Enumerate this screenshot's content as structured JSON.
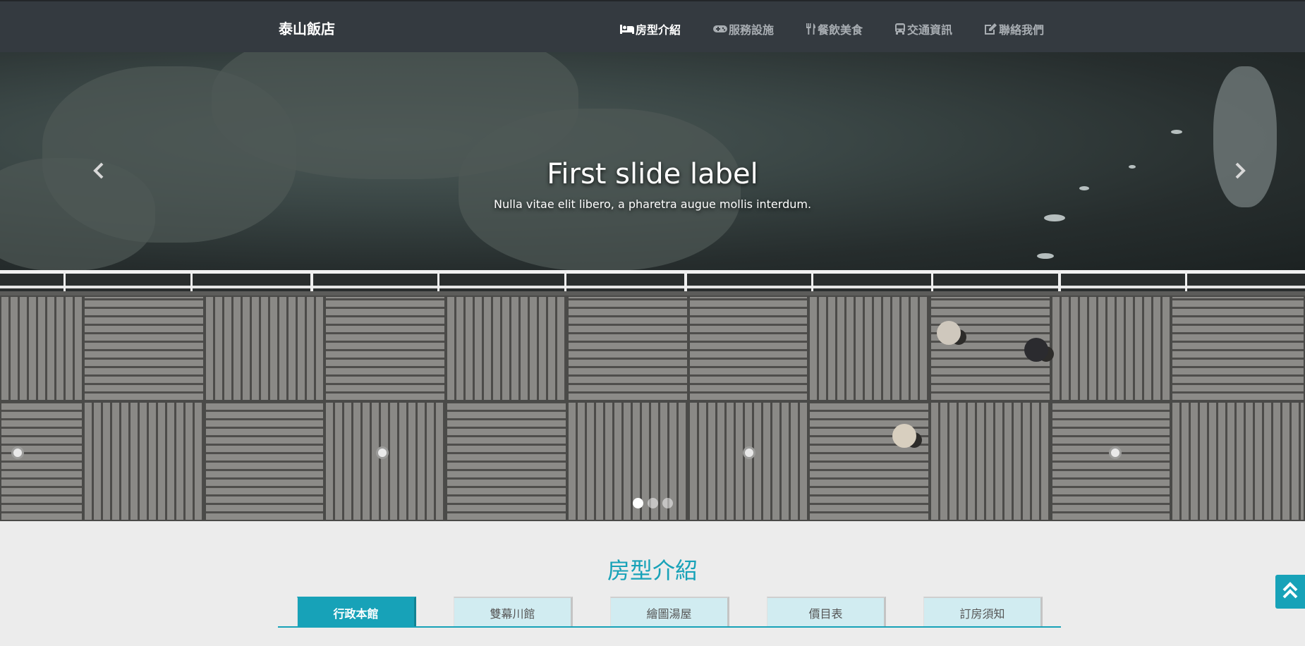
{
  "brand": "泰山飯店",
  "nav": [
    {
      "label": "房型介紹",
      "icon": "bed-icon",
      "active": true
    },
    {
      "label": "服務設施",
      "icon": "gamepad-icon",
      "active": false
    },
    {
      "label": "餐飲美食",
      "icon": "utensils-icon",
      "active": false
    },
    {
      "label": "交通資訊",
      "icon": "bus-icon",
      "active": false
    },
    {
      "label": "聯絡我們",
      "icon": "edit-icon",
      "active": false
    }
  ],
  "carousel": {
    "title": "First slide label",
    "text": "Nulla vitae elit libero, a pharetra augue mollis interdum.",
    "slide_count": 3,
    "active_slide": 1
  },
  "section": {
    "title": "房型介紹",
    "tabs": [
      "行政本館",
      "雙幕川館",
      "繪圖湯屋",
      "價目表",
      "訂房須知"
    ],
    "active_tab": 0
  },
  "colors": {
    "navbar": "#343a40",
    "accent": "#17a2b8",
    "tab_bg": "#d1ecf1",
    "page_bg": "#ececec"
  }
}
